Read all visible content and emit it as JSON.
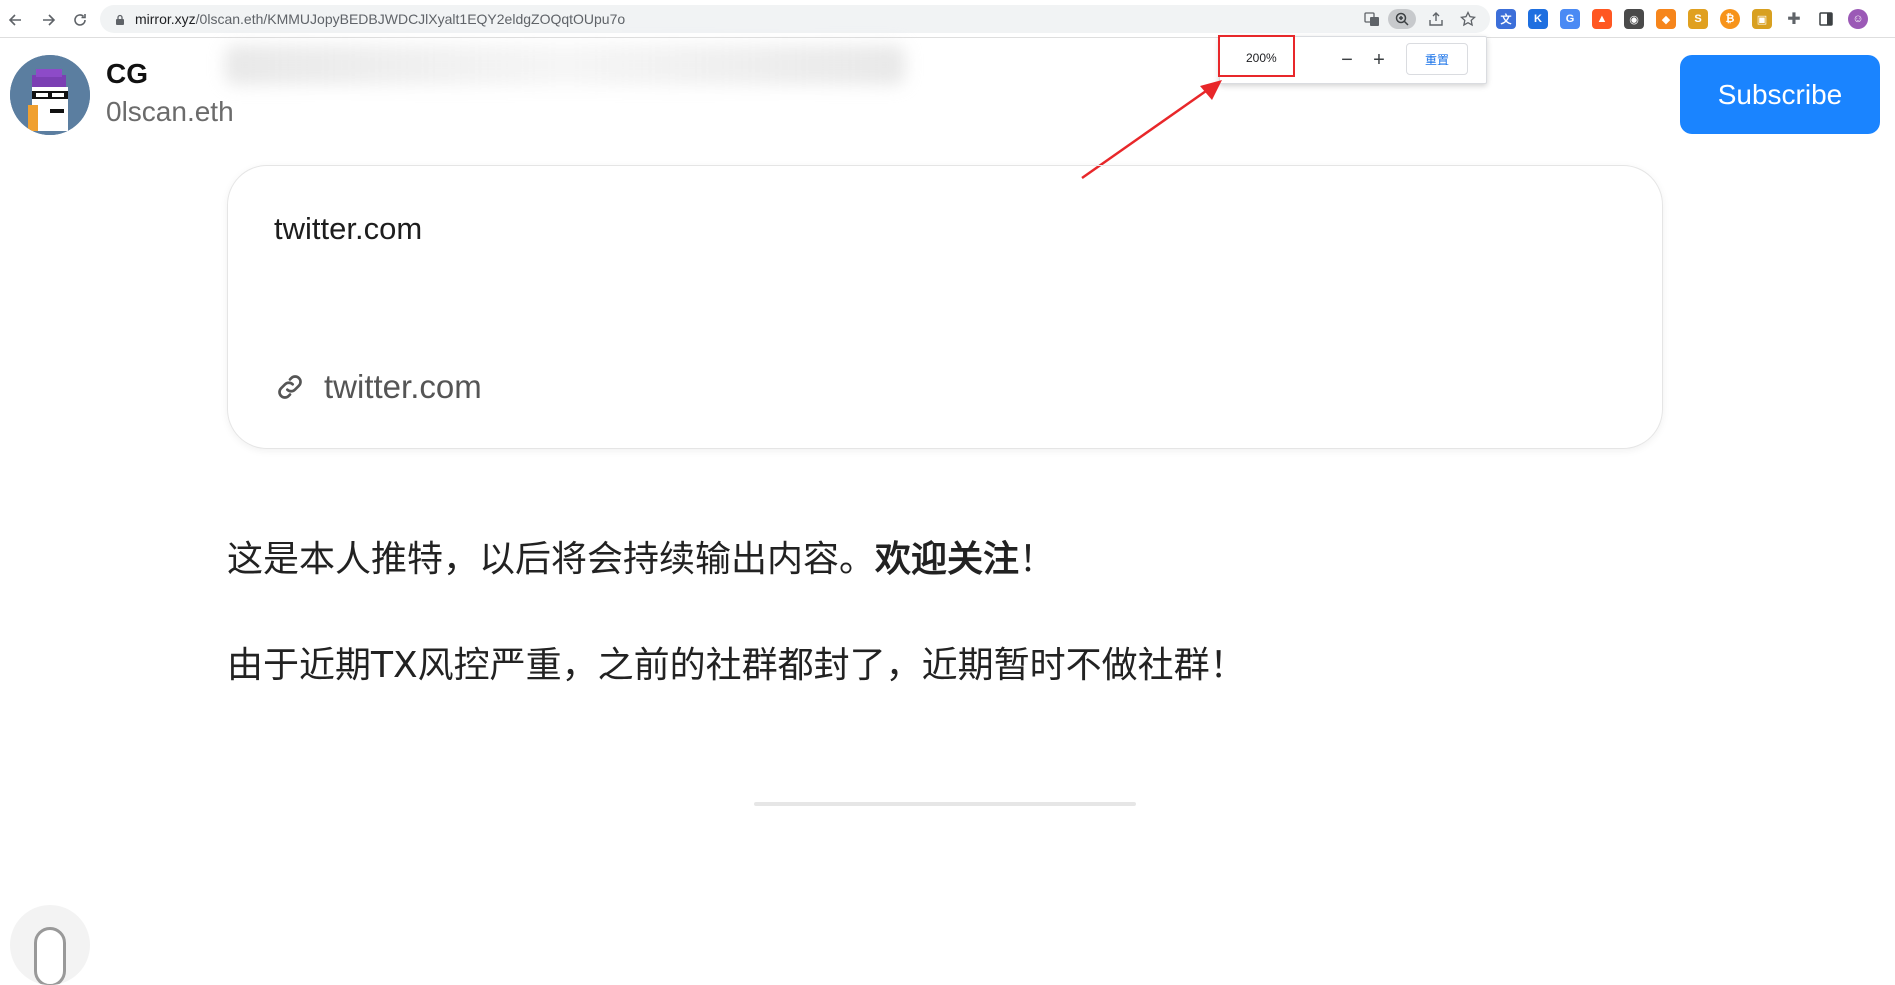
{
  "browser": {
    "url_host": "mirror.xyz",
    "url_path": "/0lscan.eth/KMMUJopyBEDBJWDCJlXyalt1EQY2eldgZOQqtOUpu7o",
    "zoom": {
      "value": "200%",
      "minus_label": "−",
      "plus_label": "+",
      "reset_label": "重置"
    },
    "colors": {
      "highlight": "#e8272a",
      "accent": "#1a73e8"
    }
  },
  "author": {
    "name": "CG",
    "handle": "0lscan.eth"
  },
  "header": {
    "subscribe_label": "Subscribe"
  },
  "embed_card": {
    "title": "twitter.com",
    "link_text": "twitter.com"
  },
  "content": {
    "para1_main": "这是本人推特，以后将会持续输出内容。",
    "para1_bold": "欢迎关注",
    "para1_end": "！",
    "para2": "由于近期TX风控严重，之前的社群都封了，近期暂时不做社群！"
  },
  "icons": {
    "back": "back-arrow-icon",
    "forward": "forward-arrow-icon",
    "reload": "reload-icon",
    "lock": "lock-icon",
    "translate": "translate-icon",
    "zoom": "zoom-icon",
    "share": "share-icon",
    "bookmark": "star-icon",
    "extensions": "puzzle-icon",
    "sidepanel": "side-panel-icon",
    "link": "link-icon"
  }
}
